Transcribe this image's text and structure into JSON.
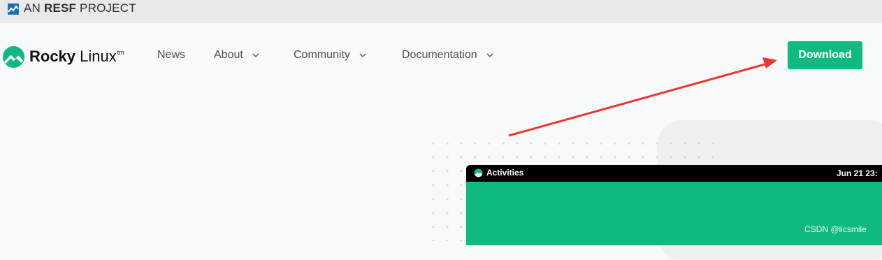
{
  "topbar": {
    "prefix": "AN",
    "brand": "RESF",
    "suffix": "PROJECT"
  },
  "logo": {
    "word1": "Rocky",
    "word2": "Linux",
    "tm": "tm"
  },
  "nav": {
    "items": [
      {
        "label": "News",
        "has_dropdown": false
      },
      {
        "label": "About",
        "has_dropdown": true
      },
      {
        "label": "Community",
        "has_dropdown": true
      },
      {
        "label": "Documentation",
        "has_dropdown": true
      }
    ],
    "download_label": "Download"
  },
  "screenshot_preview": {
    "activities_label": "Activities",
    "clock": "Jun 21  23:"
  },
  "watermark": "CSDN @licsmile",
  "colors": {
    "brand_green": "#10b981",
    "annotation_arrow": "#e53935",
    "topbar_bg": "#e8e9eb"
  }
}
